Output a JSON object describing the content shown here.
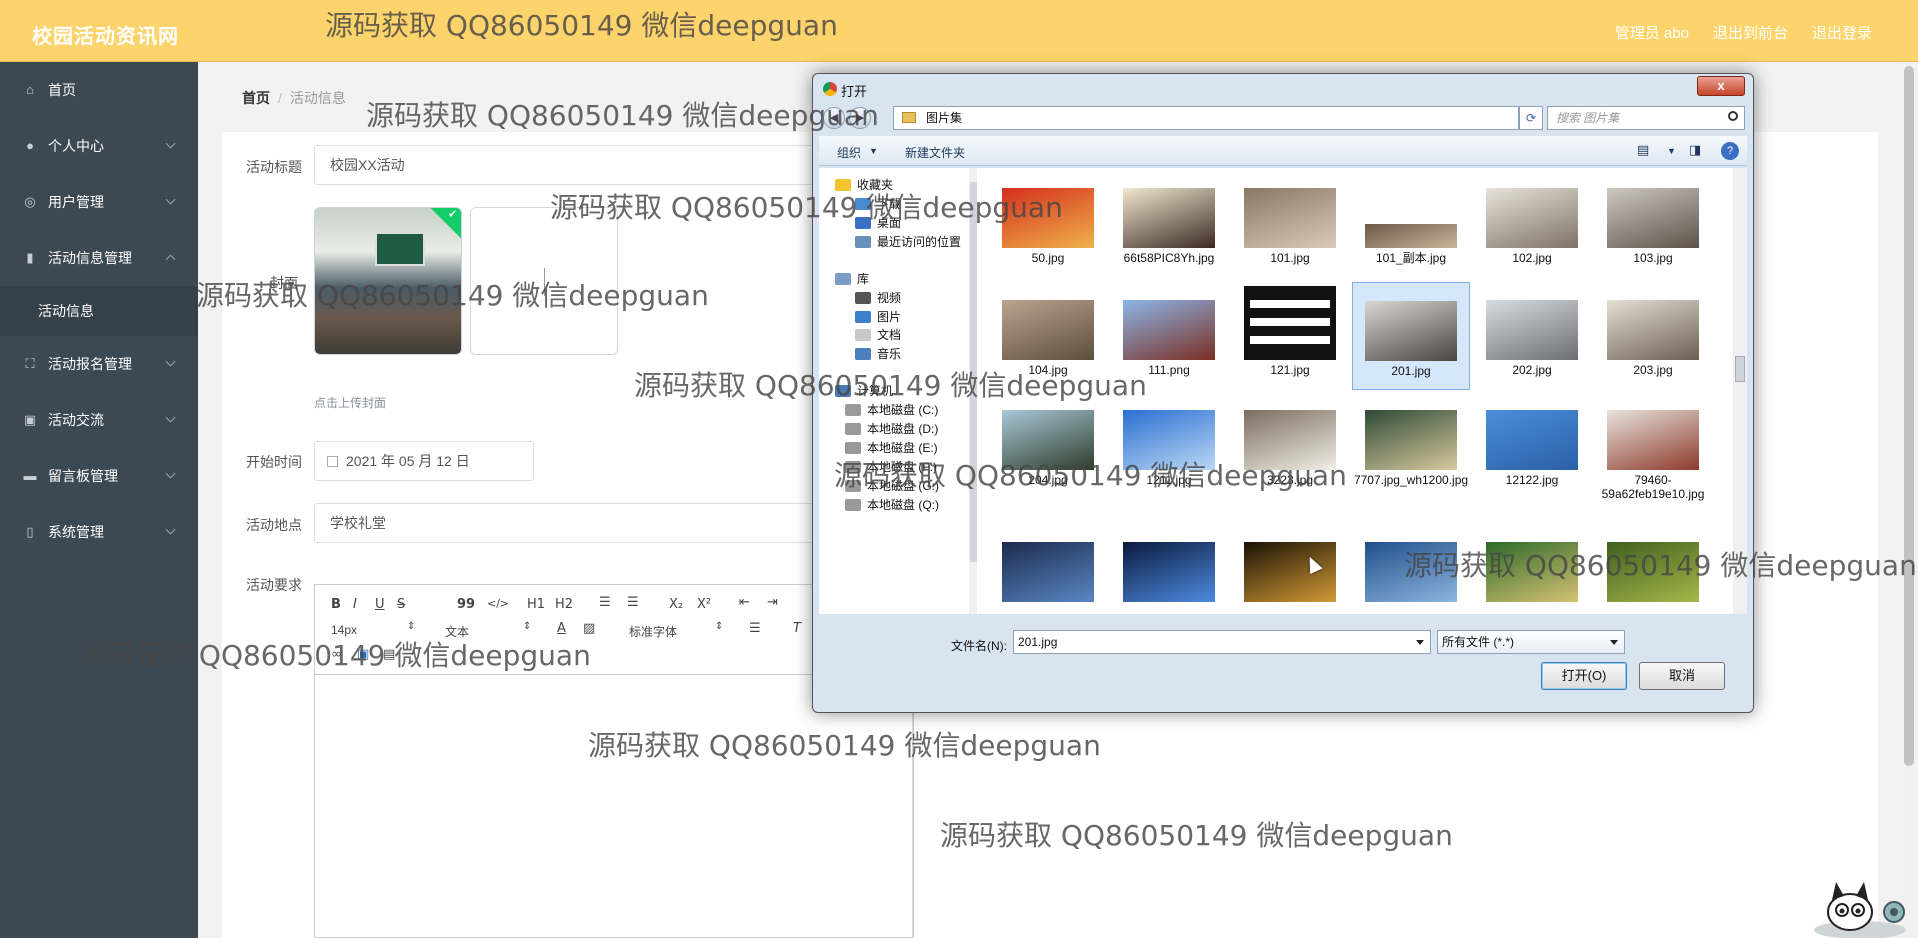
{
  "header": {
    "brand": "校园活动资讯网",
    "user_label": "管理员 abo",
    "back_console": "退出到前台",
    "logout": "退出登录"
  },
  "sidebar": {
    "items": [
      {
        "label": "首页",
        "icon": "home-icon"
      },
      {
        "label": "个人中心",
        "icon": "user-icon"
      },
      {
        "label": "用户管理",
        "icon": "users-icon"
      },
      {
        "label": "活动信息管理",
        "icon": "bar-chart-icon"
      },
      {
        "label": "活动报名管理",
        "icon": "frame-icon"
      },
      {
        "label": "活动交流",
        "icon": "clipboard-icon"
      },
      {
        "label": "留言板管理",
        "icon": "monitor-icon"
      },
      {
        "label": "系统管理",
        "icon": "battery-icon"
      }
    ],
    "sub_item": "活动信息"
  },
  "breadcrumb": {
    "home": "首页",
    "sep": "/",
    "current": "活动信息"
  },
  "form": {
    "title_label": "活动标题",
    "title_value": "校园XX活动",
    "cover_label": "封面",
    "upload_hint": "点击上传封面",
    "start_label": "开始时间",
    "start_value": "2021 年 05 月 12 日",
    "place_label": "活动地点",
    "place_value": "学校礼堂",
    "req_label": "活动要求"
  },
  "editor": {
    "bold": "B",
    "italic": "I",
    "underline": "U",
    "strike": "S",
    "quote": "99",
    "code": "</>",
    "h1": "H1",
    "h2": "H2",
    "sub": "X₂",
    "sup": "X²",
    "font_size": "14px",
    "text_style": "文本",
    "font_family": "标准字体"
  },
  "dialog": {
    "title": "打开",
    "close": "x",
    "path": "图片集",
    "search_placeholder": "搜索 图片集",
    "organize": "组织",
    "new_folder": "新建文件夹",
    "help": "?",
    "tree": [
      {
        "label": "收藏夹",
        "color": "#f4c430"
      },
      {
        "label": "下载",
        "color": "#4a8ad0"
      },
      {
        "label": "桌面",
        "color": "#3a6fc4"
      },
      {
        "label": "最近访问的位置",
        "color": "#6a8fb8"
      },
      {
        "label": "库",
        "color": "#7b9cc4"
      },
      {
        "label": "视频",
        "color": "#555"
      },
      {
        "label": "图片",
        "color": "#3d7fc9"
      },
      {
        "label": "文档",
        "color": "#c9c9c9"
      },
      {
        "label": "音乐",
        "color": "#4c7fc0"
      },
      {
        "label": "计算机",
        "color": "#4d7ab0"
      },
      {
        "label": "本地磁盘 (C:)",
        "color": "#999"
      },
      {
        "label": "本地磁盘 (D:)",
        "color": "#999"
      },
      {
        "label": "本地磁盘 (E:)",
        "color": "#999"
      },
      {
        "label": "本地磁盘 (F:)",
        "color": "#999"
      },
      {
        "label": "本地磁盘 (G:)",
        "color": "#999"
      },
      {
        "label": "本地磁盘 (Q:)",
        "color": "#999"
      }
    ],
    "files": [
      {
        "name": "50.jpg",
        "c1": "#d32f1e",
        "c2": "#f0b24a"
      },
      {
        "name": "66t58PIC8Yh.jpg",
        "c1": "#f2e7d0",
        "c2": "#3b2a22"
      },
      {
        "name": "101.jpg",
        "c1": "#8a7766",
        "c2": "#d9cbb8"
      },
      {
        "name": "101_副本.jpg",
        "c1": "#6e5a48",
        "c2": "#c9b39a"
      },
      {
        "name": "102.jpg",
        "c1": "#e9e3db",
        "c2": "#7d7266"
      },
      {
        "name": "103.jpg",
        "c1": "#cfc9c1",
        "c2": "#5c524a"
      },
      {
        "name": "104.jpg",
        "c1": "#b9a48e",
        "c2": "#5e4e3e"
      },
      {
        "name": "111.png",
        "c1": "#8db6e8",
        "c2": "#7a2e22"
      },
      {
        "name": "121.jpg",
        "c1": "#ffffff",
        "c2": "#111111"
      },
      {
        "name": "201.jpg",
        "c1": "#dcd6d0",
        "c2": "#4a4440"
      },
      {
        "name": "202.jpg",
        "c1": "#d9dde2",
        "c2": "#6b6f75"
      },
      {
        "name": "203.jpg",
        "c1": "#e6dfd4",
        "c2": "#6b5f52"
      },
      {
        "name": "204.jpg",
        "c1": "#a9c7d8",
        "c2": "#2e3d2a"
      },
      {
        "name": "1211.jpg",
        "c1": "#2a6fd1",
        "c2": "#bcd8f5"
      },
      {
        "name": "3223.jpg",
        "c1": "#7a6e5f",
        "c2": "#f2eee6"
      },
      {
        "name": "7707.jpg_wh1200.jpg",
        "c1": "#2f4a36",
        "c2": "#d7c99e"
      },
      {
        "name": "12122.jpg",
        "c1": "#4a8fd8",
        "c2": "#2a5fa8"
      },
      {
        "name": "79460-59a62feb19e10.jpg",
        "c1": "#e7e3dc",
        "c2": "#8e3a2c"
      },
      {
        "name": "",
        "c1": "#1c2b4d",
        "c2": "#5a86c4"
      },
      {
        "name": "",
        "c1": "#0a1a3d",
        "c2": "#4d8be0"
      },
      {
        "name": "",
        "c1": "#1a1206",
        "c2": "#d39a36"
      },
      {
        "name": "",
        "c1": "#1f4f8a",
        "c2": "#8fb5e0"
      },
      {
        "name": "",
        "c1": "#2c6a2a",
        "c2": "#d7c272"
      },
      {
        "name": "",
        "c1": "#3f5f1e",
        "c2": "#a6b84a"
      }
    ],
    "filename_label": "文件名(N):",
    "filename_value": "201.jpg",
    "filetype_value": "所有文件 (*.*)",
    "open_btn": "打开(O)",
    "cancel_btn": "取消"
  },
  "watermarks": [
    "源码获取 QQ86050149 微信deepguan",
    "源码获取 QQ86050149 微信deepguan",
    "源码获取 QQ86050149 微信deepguan",
    "源码获取 QQ86050149 微信deepguan",
    "源码获取 QQ86050149 微信deepguan",
    "源码获取 QQ86050149 微信deepguan",
    "源码获取 QQ86050149 微信deepguan",
    "源码获取 QQ86050149 微信deepguan",
    "源码获取 QQ86050149 微信deepguan",
    "源码获取 QQ86050149 微信deepguan"
  ]
}
